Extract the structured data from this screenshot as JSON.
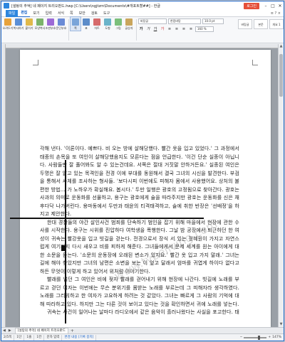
{
  "titlebar": {
    "title": "[설탕의 추억] 네 페이지 트리오판드.hwp [C:\\Users\\ngjtzm\\Documents\\#개포트할##] - 한글",
    "login_label": "로그인",
    "minimize": "–",
    "maximize": "□",
    "close": "✕"
  },
  "menu": {
    "tabs": [
      "파일",
      "편집",
      "보기",
      "입력",
      "서식",
      "쪽",
      "보안",
      "검토",
      "도구"
    ],
    "active_tab": "편집",
    "right_links": "≡ ? ×"
  },
  "ribbon": {
    "buttons": [
      {
        "label": "오려두기",
        "color": "#e7a23b"
      },
      {
        "label": "복사하기",
        "color": "#5b8fd6"
      },
      {
        "label": "붙이기",
        "color": "#e0b94a"
      },
      {
        "label": "모양복사",
        "color": "#7bb36a"
      },
      {
        "label": "조판부호",
        "color": "#9c6ad6"
      },
      {
        "label": "문단부호",
        "color": "#6a8bd6"
      }
    ],
    "buttons2": [
      {
        "label": "쪽",
        "color": "#7aa5d9"
      },
      {
        "label": "표",
        "color": "#5c8cc9"
      },
      {
        "label": "차트",
        "color": "#d66a6a"
      },
      {
        "label": "도형",
        "color": "#6ab3c9"
      },
      {
        "label": "그림",
        "color": "#7bbf7b"
      },
      {
        "label": "글상자",
        "color": "#c9a55c"
      }
    ],
    "format": {
      "style_combo": "바탕글",
      "font_combo": "한컴바탕",
      "size_combo": "10.0 pt",
      "spacing_combo": "160 %"
    },
    "format_buttons": [
      "가",
      "가",
      "가",
      "가",
      "≡",
      "≡",
      "≡",
      "≡"
    ],
    "styles": [
      "바탕글",
      "본문",
      "개요 1"
    ]
  },
  "document": {
    "paragraphs": [
      "각해 낸다. '이론이다. 예쁘다. 비 오는 방에 살해당했다. 빨간 옷을 입고 있었다.' 그 과정에서 태종의 손목을 또 여인이 살해당했음지도 모른다는 점을 언급한다. '이건 단순 실종이 아닙니다. 사람들만 잘 풀어봐도 알 수 있는건데요. 서쪽은 절대 거짓말 안하거든요.' 실종된 여인은 두명은 잘 알고 있는 목격인을 전경 이에 부대를 동원해서 결국 그녀의 시신을 발견한다. 부검을 통해서 사체를 조사하는 형사들. '보다시피 이번에도 피해자 몸에서 사용했어요. 상처의 불편한 방법... 가 노하우가 확실해요. 봅시다.' 두만 일행은 광호의 고정됨으로 찾아간다. 광호는 사과의 의미로 운동화를 선물하고, 용구는 광호에게 술을 따라주지만 광호는 운동화를 신은 채 후다닥 나가버린다. 용마동에서 두만과 태윤의 티격태격하고, 술에 취한 반장은 '선배정'을 하지고 제안한다.",
      "한대 경찰들의 야간 살인사건 범죄를 단속하기 범인을 잡기 위해 마을에서 현장에 관한 수사를 시작한다. 용구는 시위를 진압하다 여학생을 폭행한다. 그날 밤 공장에서 퇴근하던 한 여성이 귀속는 빨강옷을 입고 빗길을 걷는다. 전경으로서 장식 서 있는 정혜원이 가지고 자연스럽게 여기까지 다시 새우고 비를 피하게 해준다. 그녀들에게서 문제 세계를 원는 아이에게 대한 소문을 듣는다. '소문의 운동장에 오래된 변소가 있지요.' 빨간 옷 입고 가지 말래.' 그녀는 길에 해야 찾았지만 그녀의 남편은 소변을 보는 이 엎고 달래서 엄마를 귀엽게 하이다 없다고 하든 무엇이 이렇게 하고 있어서 위처럼 이야기한다.",
      "빨래를 널던 그 여인은 비에 젖자 빨래를 걷어내기 위해 현장에 나간다. 빗길에 노래를 부르고 걷던 여자는 이번에는 무슨 분위기를 몸받는 노래를 부르는데 그 피해자라 생각하였다. 노래를 그리워하고 한 여자가 고요하게 하려는 것 같았다. 그녀는 빠르게 그 사람의 기억에 대해 따라하고 있다. 하지만 그는 다른 것이 보이고 있다는 것을 확인하면서 귀에 노래를 넣는다.",
      "귀속는 사건이 일어나는 날마다 라디오에서 같은 음악이 흘러나왔다는 사실을 포고한다. 태"
    ]
  },
  "watermark": "www.typeliving.com",
  "doctabs": {
    "tab_label": "[설탕의 추억] 네 페이지 트리오판드",
    "plus": "+"
  },
  "status": {
    "page": "2/5쪽",
    "section": "1단",
    "line": "1줄",
    "col": "1칸",
    "chars": "문자 입력",
    "changes": "변경 내용 [기록 중지]",
    "zoom_level": "147%"
  }
}
